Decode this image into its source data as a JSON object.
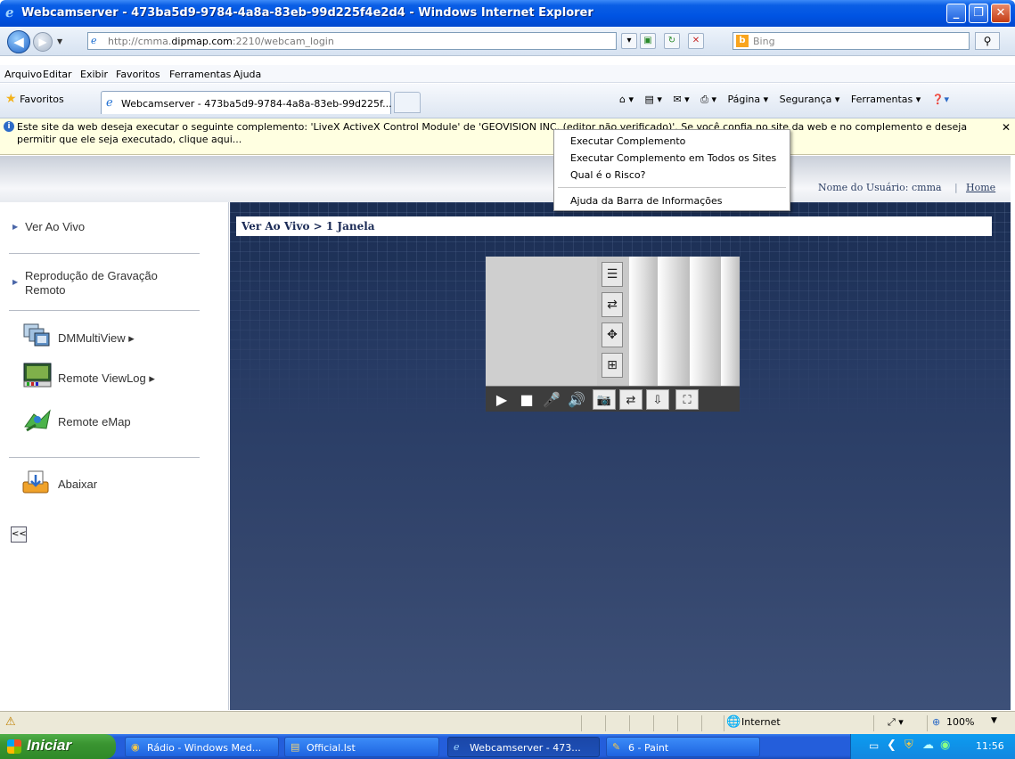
{
  "window": {
    "title": "Webcamserver - 473ba5d9-9784-4a8a-83eb-99d225f4e2d4 - Windows Internet Explorer"
  },
  "address": {
    "url_prefix": "http://cmma.",
    "url_domain": "dipmap.com",
    "url_suffix": ":2210/webcam_login",
    "search_placeholder": "Bing"
  },
  "menu": [
    "Arquivo",
    "Editar",
    "Exibir",
    "Favoritos",
    "Ferramentas",
    "Ajuda"
  ],
  "favbar": {
    "favorites_label": "Favoritos",
    "tab_label": "Webcamserver - 473ba5d9-9784-4a8a-83eb-99d225f...",
    "pagina": "Página ▾",
    "seguranca": "Segurança ▾",
    "ferramentas": "Ferramentas ▾"
  },
  "infobar": {
    "text": "Este site da web deseja executar o seguinte complemento: 'LiveX ActiveX Control Module' de 'GEOVISION INC. (editor não verificado)'. Se você confia no site da web e no complemento e deseja permitir que ele seja executado, clique aqui..."
  },
  "context_menu": {
    "items": [
      "Executar Complemento",
      "Executar Complemento em Todos os Sites",
      "Qual é o Risco?",
      "Ajuda da Barra de Informações"
    ]
  },
  "header": {
    "user_label": "Nome do Usuário: cmma",
    "sep": "|",
    "home": "Home"
  },
  "sidebar": {
    "ver_ao_vivo": "Ver Ao Vivo",
    "reproducao": "Reprodução de Gravação Remoto",
    "multiview": "DMMultiView ▸",
    "viewlog": "Remote ViewLog ▸",
    "emap": "Remote eMap",
    "abaixar": "Abaixar",
    "collapse": "<<"
  },
  "content": {
    "breadcrumb": "Ver Ao Vivo > 1 Janela"
  },
  "status": {
    "zone": "Internet",
    "zoom": "100%"
  },
  "taskbar": {
    "start": "Iniciar",
    "tasks": [
      "Rádio - Windows Med...",
      "Official.lst",
      "Webcamserver - 473...",
      "6 - Paint"
    ],
    "clock": "11:56"
  },
  "colors": {
    "title_bar": "#0054e3",
    "content_bg": "#263a63",
    "infobar": "#ffffe1",
    "taskbar": "#245edb",
    "start": "#3a9431"
  },
  "icons": [
    "ie-icon",
    "back-arrow-icon",
    "forward-arrow-icon",
    "star-icon",
    "info-icon",
    "close-icon",
    "camera-list-icon",
    "ptz-icon",
    "play-icon",
    "stop-icon",
    "microphone-icon",
    "speaker-icon",
    "snapshot-icon",
    "fullscreen-icon"
  ]
}
